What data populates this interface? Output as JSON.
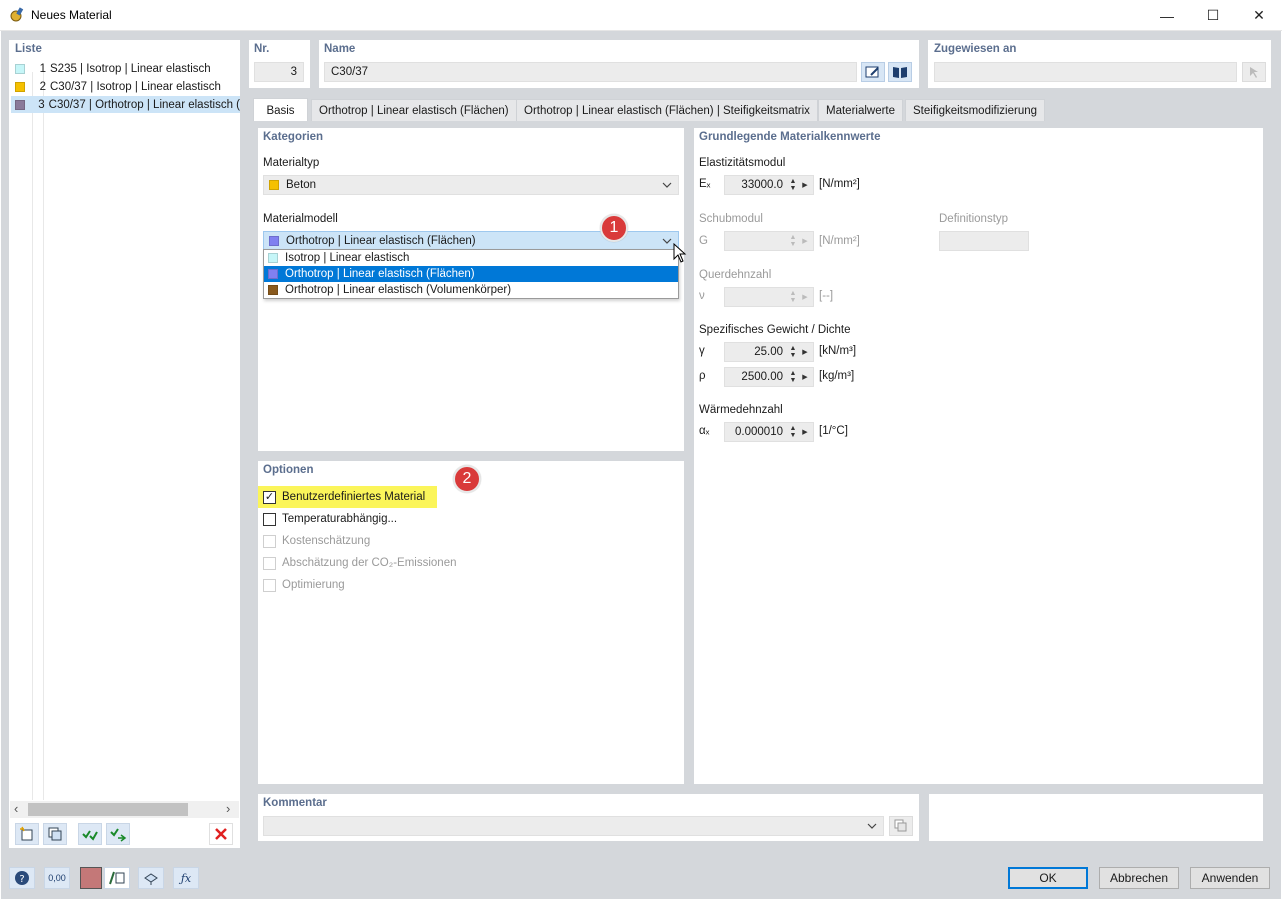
{
  "window": {
    "title": "Neues Material",
    "minimize": "—",
    "maximize": "☐",
    "close": "✕"
  },
  "list": {
    "label": "Liste",
    "items": [
      {
        "num": "1",
        "text": "S235 | Isotrop | Linear elastisch",
        "color": "#c6f6f8"
      },
      {
        "num": "2",
        "text": "C30/37 | Isotrop | Linear elastisch",
        "color": "#f5c000"
      },
      {
        "num": "3",
        "text": "C30/37 | Orthotrop | Linear elastisch (",
        "color": "#8a7a9a"
      }
    ],
    "scroll_left": "‹",
    "scroll_right": "›"
  },
  "header": {
    "nr_label": "Nr.",
    "nr_value": "3",
    "name_label": "Name",
    "name_value": "C30/37",
    "assigned_label": "Zugewiesen an",
    "assigned_value": ""
  },
  "tabs": [
    {
      "label": "Basis"
    },
    {
      "label": "Orthotrop | Linear elastisch (Flächen)"
    },
    {
      "label": "Orthotrop | Linear elastisch (Flächen) | Steifigkeitsmatrix"
    },
    {
      "label": "Materialwerte"
    },
    {
      "label": "Steifigkeitsmodifizierung"
    }
  ],
  "kategorien": {
    "title": "Kategorien",
    "materialtyp_label": "Materialtyp",
    "materialtyp_value": "Beton",
    "materialtyp_color": "#f5c000",
    "materialmodell_label": "Materialmodell",
    "materialmodell_value": "Orthotrop | Linear elastisch (Flächen)",
    "materialmodell_color": "#8080f0",
    "options": [
      {
        "text": "Isotrop | Linear elastisch",
        "color": "#c6f6f8"
      },
      {
        "text": "Orthotrop | Linear elastisch (Flächen)",
        "color": "#8080f0"
      },
      {
        "text": "Orthotrop | Linear elastisch (Volumenkörper)",
        "color": "#8a5a1e"
      }
    ],
    "selected_option": "Orthotrop | Linear elastisch (Flächen)"
  },
  "callouts": {
    "one": "1",
    "two": "2"
  },
  "optionen": {
    "title": "Optionen",
    "items": [
      {
        "label": "Benutzerdefiniertes Material",
        "checked": true,
        "enabled": true
      },
      {
        "label": "Temperaturabhängig...",
        "checked": false,
        "enabled": true
      },
      {
        "label": "Kostenschätzung",
        "checked": false,
        "enabled": false
      },
      {
        "label": "Abschätzung der CO₂-Emissionen",
        "checked": false,
        "enabled": false
      },
      {
        "label": "Optimierung",
        "checked": false,
        "enabled": false
      }
    ],
    "check_mark": "✓"
  },
  "kennwerte": {
    "title": "Grundlegende Materialkennwerte",
    "elastizitaet_label": "Elastizitätsmodul",
    "ex_symbol": "Eₓ",
    "ex_value": "33000.0",
    "ex_unit": "[N/mm²]",
    "schub_label": "Schubmodul",
    "g_symbol": "G",
    "g_value": "",
    "g_unit": "[N/mm²]",
    "deftyp_label": "Definitionstyp",
    "deftyp_value": "",
    "quer_label": "Querdehnzahl",
    "nu_symbol": "ν",
    "nu_value": "",
    "nu_unit": "[--]",
    "gewicht_label": "Spezifisches Gewicht / Dichte",
    "gamma_symbol": "γ",
    "gamma_value": "25.00",
    "gamma_unit": "[kN/m³]",
    "rho_symbol": "ρ",
    "rho_value": "2500.00",
    "rho_unit": "[kg/m³]",
    "waerme_label": "Wärmedehnzahl",
    "alpha_symbol": "αₓ",
    "alpha_value": "0.000010",
    "alpha_unit": "[1/°C]"
  },
  "kommentar": {
    "label": "Kommentar",
    "value": ""
  },
  "buttons": {
    "ok": "OK",
    "cancel": "Abbrechen",
    "apply": "Anwenden"
  },
  "bottom_tools": {
    "units_label": "0,00"
  }
}
